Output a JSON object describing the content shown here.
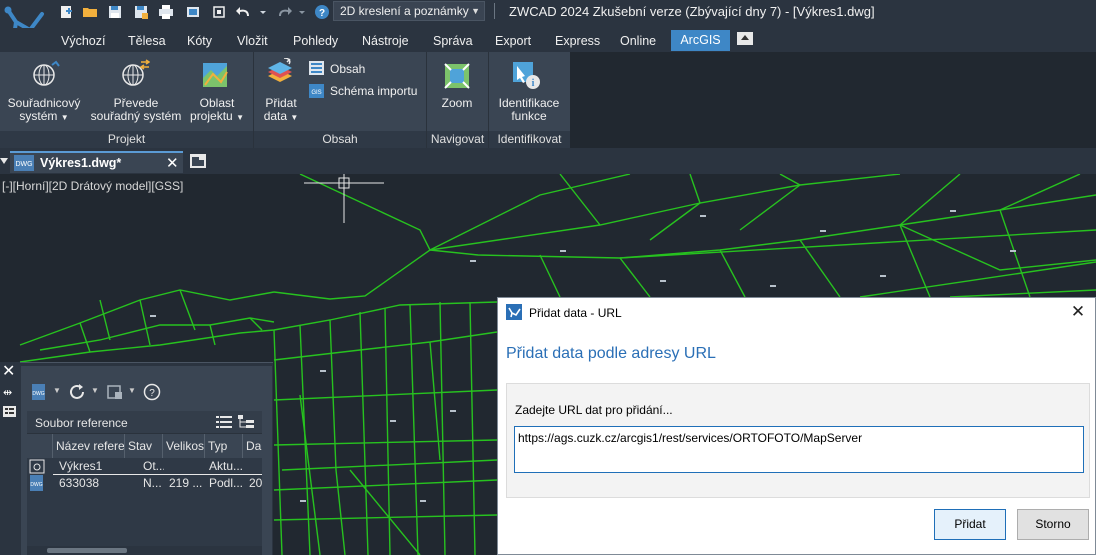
{
  "app": {
    "window_title": "ZWCAD 2024 Zkušební verze (Zbývající dny 7) - [Výkres1.dwg]",
    "workspace": "2D kreslení a poznámky"
  },
  "menu": {
    "tabs": [
      "Výchozí",
      "Tělesa",
      "Kóty",
      "Vložit",
      "Pohledy",
      "Nástroje",
      "Správa",
      "Export",
      "Express",
      "Online"
    ],
    "active_tab": "ArcGIS"
  },
  "ribbon": {
    "panels": {
      "projekt": "Projekt",
      "obsah": "Obsah",
      "navigovat": "Navigovat",
      "identifikovat": "Identifikovat"
    },
    "buttons": {
      "coord_system_l1": "Souřadnicový",
      "coord_system_l2": "systém",
      "transform_l1": "Převede",
      "transform_l2": "souřadný systém",
      "area_l1": "Oblast",
      "area_l2": "projektu",
      "add_data_l1": "Přidat",
      "add_data_l2": "data",
      "content": "Obsah",
      "import_schema": "Schéma importu",
      "zoom": "Zoom",
      "identify_l1": "Identifikace",
      "identify_l2": "funkce"
    }
  },
  "document": {
    "tab_label": "Výkres1.dwg*",
    "viewport_label": "[-][Horní][2D Drátový model][GSS]"
  },
  "reference_panel": {
    "header": "Soubor reference",
    "columns": [
      "Název referen",
      "Stav",
      "Velikost",
      "Typ",
      "Da"
    ],
    "rows": [
      [
        "Výkres1",
        "Ot...",
        "",
        "Aktu...",
        ""
      ],
      [
        "633038",
        "N...",
        "219 ...",
        "Podl...",
        "20"
      ]
    ]
  },
  "dialog": {
    "title": "Přidat data - URL",
    "heading": "Přidat data podle adresy URL",
    "prompt": "Zadejte URL dat pro přidání...",
    "url_value": "https://ags.cuzk.cz/arcgis1/rest/services/ORTOFOTO/MapServer",
    "add_button": "Přidat",
    "cancel_button": "Storno"
  },
  "colors": {
    "accent": "#3e87c6",
    "drawing_lines": "#27c21f",
    "canvas_bg": "#212830"
  }
}
